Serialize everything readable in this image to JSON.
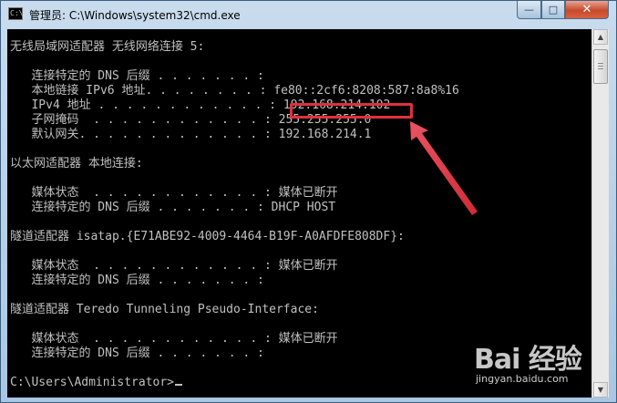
{
  "window": {
    "title": "管理员: C:\\Windows\\system32\\cmd.exe",
    "controls": {
      "minimize": "—",
      "maximize": "□",
      "close": "✕"
    }
  },
  "console": {
    "lines": [
      "无线局域网适配器 无线网络连接 5:",
      "",
      "   连接特定的 DNS 后缀 . . . . . . . :",
      "   本地链接 IPv6 地址. . . . . . . . : fe80::2cf6:8208:587:8a8%16",
      "   IPv4 地址 . . . . . . . . . . . . : 192.168.214.102",
      "   子网掩码  . . . . . . . . . . . . : 255.255.255.0",
      "   默认网关. . . . . . . . . . . . . : 192.168.214.1",
      "",
      "以太网适配器 本地连接:",
      "",
      "   媒体状态  . . . . . . . . . . . . : 媒体已断开",
      "   连接特定的 DNS 后缀 . . . . . . . : DHCP HOST",
      "",
      "隧道适配器 isatap.{E71ABE92-4009-4464-B19F-A0AFDFE808DF}:",
      "",
      "   媒体状态  . . . . . . . . . . . . : 媒体已断开",
      "   连接特定的 DNS 后缀 . . . . . . . :",
      "",
      "隧道适配器 Teredo Tunneling Pseudo-Interface:",
      "",
      "   媒体状态  . . . . . . . . . . . . : 媒体已断开",
      "   连接特定的 DNS 后缀 . . . . . . . :",
      "",
      "C:\\Users\\Administrator>"
    ]
  },
  "watermark": {
    "brand": "Bai 经验",
    "url": "jingyan.baidu.com"
  },
  "colors": {
    "console_bg": "#000000",
    "console_text": "#c0c0c0",
    "highlight": "#e0303a",
    "close_button": "#c74a2c"
  }
}
